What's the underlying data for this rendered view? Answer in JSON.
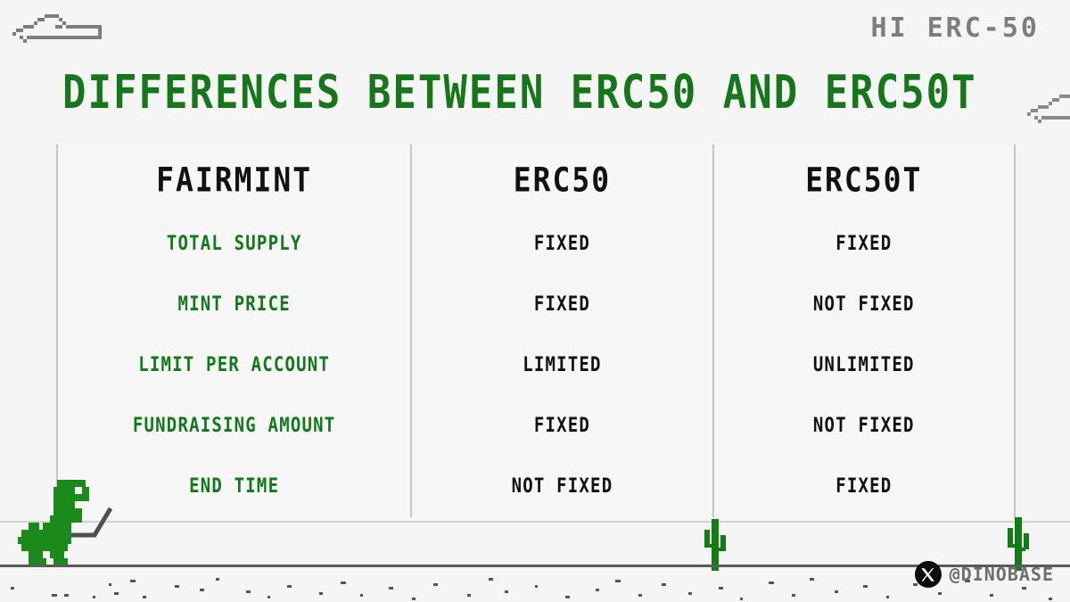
{
  "greeting": "HI ERC-50",
  "title": "DIFFERENCES BETWEEN ERC50 AND ERC50T",
  "table": {
    "headers": [
      "FAIRMINT",
      "ERC50",
      "ERC50T"
    ],
    "rows": [
      {
        "feature": "TOTAL SUPPLY",
        "erc50": "FIXED",
        "erc50t": "FIXED"
      },
      {
        "feature": "MINT PRICE",
        "erc50": "FIXED",
        "erc50t": "NOT FIXED"
      },
      {
        "feature": "LIMIT PER ACCOUNT",
        "erc50": "LIMITED",
        "erc50t": "UNLIMITED"
      },
      {
        "feature": "FUNDRAISING AMOUNT",
        "erc50": "FIXED",
        "erc50t": "NOT FIXED"
      },
      {
        "feature": "END TIME",
        "erc50": "NOT FIXED",
        "erc50t": "FIXED"
      }
    ]
  },
  "watermark": {
    "handle": "@DINOBASE",
    "logo": "x-logo"
  },
  "decorations": {
    "cloud_left": "cloud-icon",
    "cloud_right": "cloud-icon",
    "dino": "trex-dino-icon",
    "cactus_1": "cactus-icon",
    "cactus_2": "cactus-icon"
  },
  "colors": {
    "background": "#f5f5f5",
    "accent_green": "#12791a",
    "title_green": "#15771a",
    "text_black": "#111111",
    "muted_gray": "#7d7d7d",
    "border_gray": "#c6c6c6",
    "ground_gray": "#5a5a5a"
  }
}
